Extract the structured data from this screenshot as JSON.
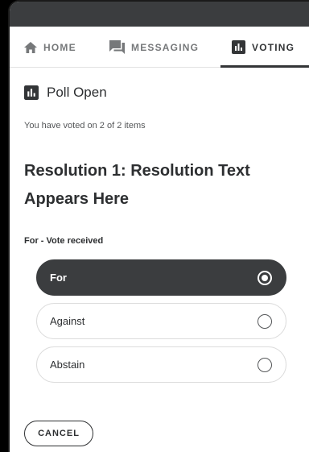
{
  "nav": {
    "tabs": [
      {
        "label": "HOME",
        "icon": "home-icon",
        "active": false
      },
      {
        "label": "MESSAGING",
        "icon": "chat-icon",
        "active": false
      },
      {
        "label": "VOTING",
        "icon": "poll-icon",
        "active": true
      }
    ]
  },
  "poll": {
    "status": "Poll Open",
    "status_icon": "poll-icon",
    "summary": "You have voted on 2 of 2 items"
  },
  "resolution": {
    "title": "Resolution 1: Resolution Text Appears Here",
    "vote_state": "For - Vote received",
    "options": [
      {
        "label": "For",
        "selected": true
      },
      {
        "label": "Against",
        "selected": false
      },
      {
        "label": "Abstain",
        "selected": false
      }
    ]
  },
  "actions": {
    "cancel_label": "CANCEL"
  },
  "colors": {
    "dark": "#3b3d3f",
    "text": "#2d2f31",
    "muted": "#76787a",
    "border": "#dcdcdc"
  }
}
